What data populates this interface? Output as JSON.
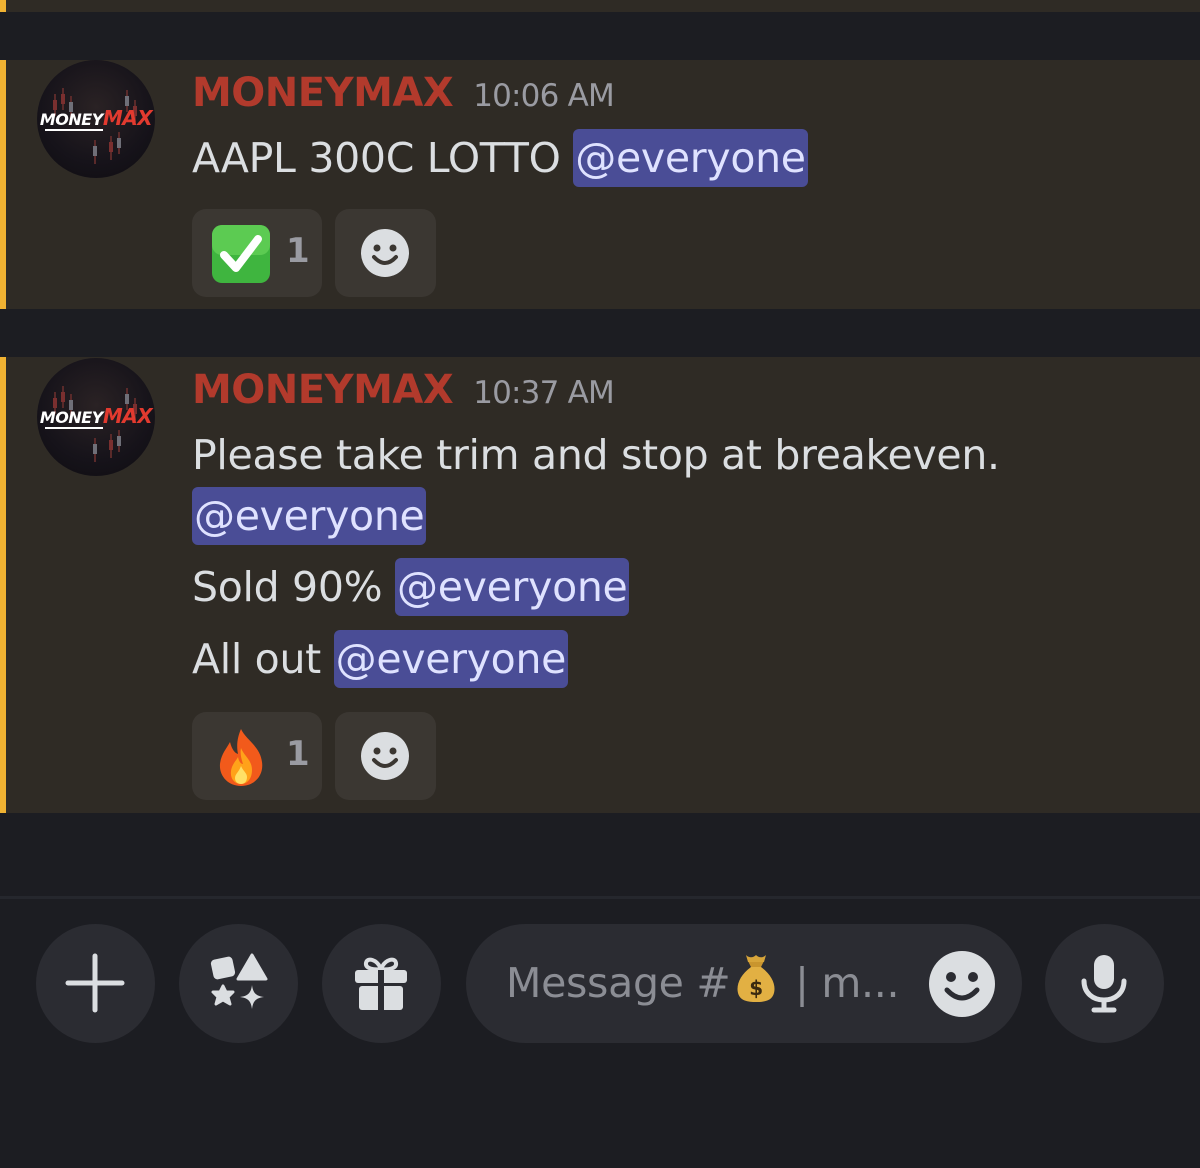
{
  "colors": {
    "highlight_border": "#f0b232",
    "highlight_bg": "#2f2b25",
    "username": "#b23a2c",
    "mention_bg": "#4a4d96"
  },
  "avatar": {
    "logo_white": "MONEY",
    "logo_red": "MAX"
  },
  "messages": [
    {
      "username": "MONEYMAX",
      "timestamp": "10:06 AM",
      "lines": [
        {
          "text": "AAPL 300C LOTTO ",
          "mention": "@everyone"
        }
      ],
      "reactions": [
        {
          "icon": "check-mark-button-icon",
          "count": "1"
        }
      ]
    },
    {
      "username": "MONEYMAX",
      "timestamp": "10:37 AM",
      "lines": [
        {
          "text": "Please take trim and stop at breakeven.",
          "mention": ""
        },
        {
          "text": "",
          "mention": "@everyone"
        },
        {
          "text": "Sold 90% ",
          "mention": "@everyone"
        },
        {
          "text": "All out ",
          "mention": "@everyone"
        }
      ],
      "reactions": [
        {
          "icon": "fire-icon",
          "count": "1"
        }
      ]
    }
  ],
  "composer": {
    "placeholder_prefix": "Message #",
    "placeholder_suffix": " | m...",
    "channel_icon": "money-bag-icon"
  },
  "toolbar_icons": [
    "plus-icon",
    "apps-icon",
    "gift-icon",
    "microphone-icon"
  ]
}
